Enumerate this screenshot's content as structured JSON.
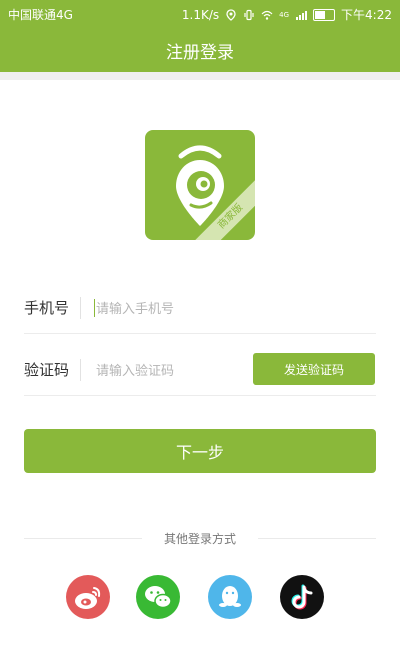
{
  "statusbar": {
    "carrier": "中国联通4G",
    "speed": "1.1K/s",
    "time": "下午4:22",
    "network_badge": "4G"
  },
  "navbar": {
    "title": "注册登录"
  },
  "logo": {
    "badge": "商家版"
  },
  "form": {
    "phone_label": "手机号",
    "phone_placeholder": "请输入手机号",
    "code_label": "验证码",
    "code_placeholder": "请输入验证码",
    "send_code_label": "发送验证码",
    "next_label": "下一步"
  },
  "other_login": {
    "label": "其他登录方式",
    "providers": [
      "weibo-icon",
      "wechat-icon",
      "qq-icon",
      "douyin-icon"
    ]
  },
  "colors": {
    "accent": "#8ab83a",
    "weibo": "#e35a5a",
    "wechat": "#39b934",
    "qq": "#4fb6ea",
    "douyin": "#111111"
  }
}
